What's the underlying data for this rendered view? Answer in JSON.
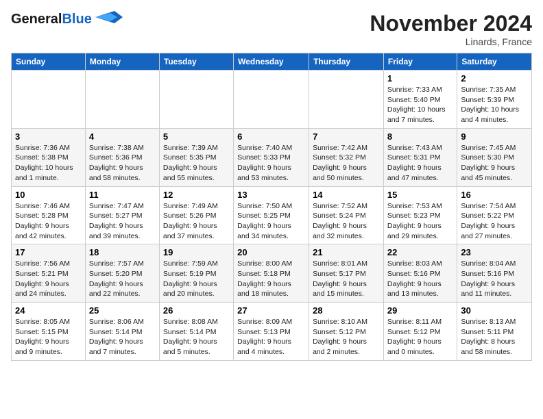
{
  "header": {
    "logo_line1": "General",
    "logo_line2": "Blue",
    "month": "November 2024",
    "location": "Linards, France"
  },
  "weekdays": [
    "Sunday",
    "Monday",
    "Tuesday",
    "Wednesday",
    "Thursday",
    "Friday",
    "Saturday"
  ],
  "weeks": [
    [
      {
        "day": "",
        "detail": ""
      },
      {
        "day": "",
        "detail": ""
      },
      {
        "day": "",
        "detail": ""
      },
      {
        "day": "",
        "detail": ""
      },
      {
        "day": "",
        "detail": ""
      },
      {
        "day": "1",
        "detail": "Sunrise: 7:33 AM\nSunset: 5:40 PM\nDaylight: 10 hours\nand 7 minutes."
      },
      {
        "day": "2",
        "detail": "Sunrise: 7:35 AM\nSunset: 5:39 PM\nDaylight: 10 hours\nand 4 minutes."
      }
    ],
    [
      {
        "day": "3",
        "detail": "Sunrise: 7:36 AM\nSunset: 5:38 PM\nDaylight: 10 hours\nand 1 minute."
      },
      {
        "day": "4",
        "detail": "Sunrise: 7:38 AM\nSunset: 5:36 PM\nDaylight: 9 hours\nand 58 minutes."
      },
      {
        "day": "5",
        "detail": "Sunrise: 7:39 AM\nSunset: 5:35 PM\nDaylight: 9 hours\nand 55 minutes."
      },
      {
        "day": "6",
        "detail": "Sunrise: 7:40 AM\nSunset: 5:33 PM\nDaylight: 9 hours\nand 53 minutes."
      },
      {
        "day": "7",
        "detail": "Sunrise: 7:42 AM\nSunset: 5:32 PM\nDaylight: 9 hours\nand 50 minutes."
      },
      {
        "day": "8",
        "detail": "Sunrise: 7:43 AM\nSunset: 5:31 PM\nDaylight: 9 hours\nand 47 minutes."
      },
      {
        "day": "9",
        "detail": "Sunrise: 7:45 AM\nSunset: 5:30 PM\nDaylight: 9 hours\nand 45 minutes."
      }
    ],
    [
      {
        "day": "10",
        "detail": "Sunrise: 7:46 AM\nSunset: 5:28 PM\nDaylight: 9 hours\nand 42 minutes."
      },
      {
        "day": "11",
        "detail": "Sunrise: 7:47 AM\nSunset: 5:27 PM\nDaylight: 9 hours\nand 39 minutes."
      },
      {
        "day": "12",
        "detail": "Sunrise: 7:49 AM\nSunset: 5:26 PM\nDaylight: 9 hours\nand 37 minutes."
      },
      {
        "day": "13",
        "detail": "Sunrise: 7:50 AM\nSunset: 5:25 PM\nDaylight: 9 hours\nand 34 minutes."
      },
      {
        "day": "14",
        "detail": "Sunrise: 7:52 AM\nSunset: 5:24 PM\nDaylight: 9 hours\nand 32 minutes."
      },
      {
        "day": "15",
        "detail": "Sunrise: 7:53 AM\nSunset: 5:23 PM\nDaylight: 9 hours\nand 29 minutes."
      },
      {
        "day": "16",
        "detail": "Sunrise: 7:54 AM\nSunset: 5:22 PM\nDaylight: 9 hours\nand 27 minutes."
      }
    ],
    [
      {
        "day": "17",
        "detail": "Sunrise: 7:56 AM\nSunset: 5:21 PM\nDaylight: 9 hours\nand 24 minutes."
      },
      {
        "day": "18",
        "detail": "Sunrise: 7:57 AM\nSunset: 5:20 PM\nDaylight: 9 hours\nand 22 minutes."
      },
      {
        "day": "19",
        "detail": "Sunrise: 7:59 AM\nSunset: 5:19 PM\nDaylight: 9 hours\nand 20 minutes."
      },
      {
        "day": "20",
        "detail": "Sunrise: 8:00 AM\nSunset: 5:18 PM\nDaylight: 9 hours\nand 18 minutes."
      },
      {
        "day": "21",
        "detail": "Sunrise: 8:01 AM\nSunset: 5:17 PM\nDaylight: 9 hours\nand 15 minutes."
      },
      {
        "day": "22",
        "detail": "Sunrise: 8:03 AM\nSunset: 5:16 PM\nDaylight: 9 hours\nand 13 minutes."
      },
      {
        "day": "23",
        "detail": "Sunrise: 8:04 AM\nSunset: 5:16 PM\nDaylight: 9 hours\nand 11 minutes."
      }
    ],
    [
      {
        "day": "24",
        "detail": "Sunrise: 8:05 AM\nSunset: 5:15 PM\nDaylight: 9 hours\nand 9 minutes."
      },
      {
        "day": "25",
        "detail": "Sunrise: 8:06 AM\nSunset: 5:14 PM\nDaylight: 9 hours\nand 7 minutes."
      },
      {
        "day": "26",
        "detail": "Sunrise: 8:08 AM\nSunset: 5:14 PM\nDaylight: 9 hours\nand 5 minutes."
      },
      {
        "day": "27",
        "detail": "Sunrise: 8:09 AM\nSunset: 5:13 PM\nDaylight: 9 hours\nand 4 minutes."
      },
      {
        "day": "28",
        "detail": "Sunrise: 8:10 AM\nSunset: 5:12 PM\nDaylight: 9 hours\nand 2 minutes."
      },
      {
        "day": "29",
        "detail": "Sunrise: 8:11 AM\nSunset: 5:12 PM\nDaylight: 9 hours\nand 0 minutes."
      },
      {
        "day": "30",
        "detail": "Sunrise: 8:13 AM\nSunset: 5:11 PM\nDaylight: 8 hours\nand 58 minutes."
      }
    ]
  ]
}
